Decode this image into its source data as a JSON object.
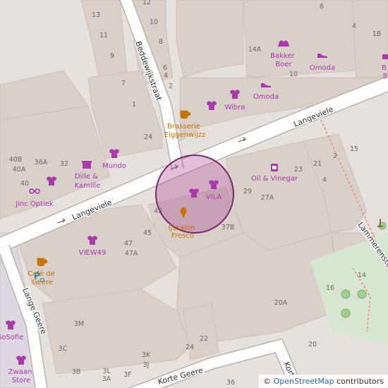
{
  "map": {
    "streets": {
      "beddewijkstraat": "Beddewijkstraat",
      "langeviele_left": "Langeviele",
      "langeviele_right": "Langeviele",
      "lange_geere": "Lange Geere",
      "korte_geere": "Korte Geere",
      "lammerensteeg": "Lammerensteeg",
      "kort": "Kort"
    },
    "pois": {
      "brasserie": [
        "Brasserie",
        "Eiggenwijzz"
      ],
      "wibra": "Wibra",
      "omoda_1": "Omoda",
      "omoda_2": "Omoda",
      "bakker_boer": [
        "Bakker",
        "Boer"
      ],
      "mundo": "Mundo",
      "dille": [
        "Dille &",
        "Kamille"
      ],
      "jinc": "Jinc Optiek",
      "oil_vinegar": "Oil & Vinegar",
      "vila": "VILA",
      "ijssalon": [
        "IJssalon",
        "Fresco"
      ],
      "view49": "VIEW49",
      "cafe": [
        "Café de",
        "Geere"
      ],
      "gosofie": "GoSofie",
      "zwaan": [
        "Zwaan",
        "Store"
      ],
      "b_partial": [
        "B",
        "B"
      ]
    },
    "house_numbers": {
      "n13": "13",
      "n12": "12",
      "n10a": "10",
      "n11": "11",
      "n8": "8",
      "n9": "9",
      "n7": "7",
      "n6": "6",
      "n4a": "4",
      "n2a": "2",
      "n1": "1",
      "n24a": "24",
      "n14a": "14A",
      "n10b": "10",
      "n6b": "6",
      "n4b": "4",
      "n2b": "2",
      "n1b": "1B",
      "n40b": "40B",
      "n36a": "36A",
      "n32": "32",
      "n40a": "40A",
      "n40": "40",
      "n23": "23",
      "n21": "21",
      "n4c": "4",
      "n15": "15",
      "n29": "29",
      "n27a": "27A",
      "n43": "43",
      "n45": "45",
      "n47": "47",
      "n47a": "47A",
      "n37b": "37B",
      "n14": "14",
      "n16": "16",
      "n20a": "20A",
      "n20": "20",
      "n3m": "3M",
      "n3c": "3C",
      "n3k": "3K",
      "n3j": "3J",
      "n24b": "24",
      "n22": "22",
      "n3b": "3B",
      "n3l": "3L",
      "n3a": "3A",
      "n3f": "3F",
      "n36": "36",
      "n2c": "2"
    },
    "colors": {
      "background": "#e6e1dc",
      "building": "#d9d0c9",
      "road": "#ffffff",
      "road_casing": "#bbb3ad",
      "poi_purple": "#ac39ac",
      "poi_orange": "#c77400",
      "highlight_fill": "#ac4a96",
      "highlight_stroke": "#7a2a6e",
      "footway": "#fa8072"
    }
  },
  "attribution": {
    "symbol": "©",
    "link_text": "OpenStreetMap",
    "suffix": "contributors"
  }
}
